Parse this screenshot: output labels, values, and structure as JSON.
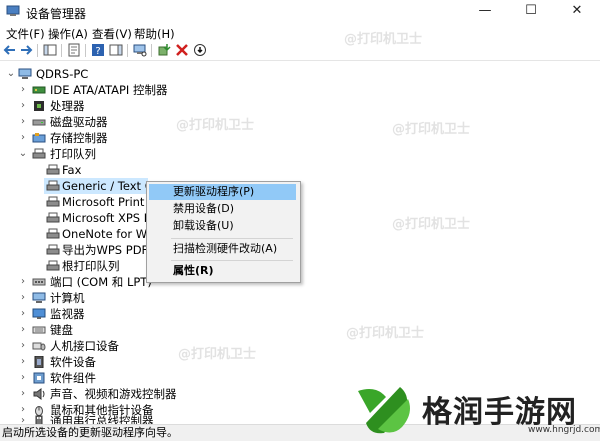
{
  "window": {
    "title": "设备管理器",
    "minimize_glyph": "—",
    "maximize_glyph": "☐",
    "close_glyph": "✕"
  },
  "menu": [
    "文件(F)",
    "操作(A)",
    "查看(V)",
    "帮助(H)"
  ],
  "tree": {
    "root": "QDRS-PC",
    "items": [
      {
        "label": "IDE ATA/ATAPI 控制器",
        "icon": "ide-controller-icon"
      },
      {
        "label": "处理器",
        "icon": "processor-icon"
      },
      {
        "label": "磁盘驱动器",
        "icon": "disk-drive-icon"
      },
      {
        "label": "存储控制器",
        "icon": "storage-controller-icon"
      },
      {
        "label": "打印队列",
        "icon": "print-queue-icon"
      },
      {
        "label": "Fax",
        "icon": "printer-icon"
      },
      {
        "label": "Generic / Text Only",
        "icon": "printer-icon"
      },
      {
        "label": "Microsoft Print to",
        "icon": "printer-icon"
      },
      {
        "label": "Microsoft XPS Doc",
        "icon": "printer-icon"
      },
      {
        "label": "OneNote for Wind",
        "icon": "printer-icon"
      },
      {
        "label": "导出为WPS PDF",
        "icon": "printer-icon"
      },
      {
        "label": "根打印队列",
        "icon": "printer-icon"
      },
      {
        "label": "端口 (COM 和 LPT)",
        "icon": "port-icon"
      },
      {
        "label": "计算机",
        "icon": "computer-icon"
      },
      {
        "label": "监视器",
        "icon": "monitor-icon"
      },
      {
        "label": "键盘",
        "icon": "keyboard-icon"
      },
      {
        "label": "人机接口设备",
        "icon": "hid-icon"
      },
      {
        "label": "软件设备",
        "icon": "software-device-icon"
      },
      {
        "label": "软件组件",
        "icon": "software-component-icon"
      },
      {
        "label": "声音、视频和游戏控制器",
        "icon": "sound-icon"
      },
      {
        "label": "鼠标和其他指针设备",
        "icon": "mouse-icon"
      },
      {
        "label": "通用串行总线控制器",
        "icon": "usb-icon"
      }
    ]
  },
  "context_menu": {
    "update_driver": "更新驱动程序(P)",
    "disable_device": "禁用设备(D)",
    "uninstall_device": "卸载设备(U)",
    "scan_hardware": "扫描检测硬件改动(A)",
    "properties": "属性(R)"
  },
  "status_bar": "启动所选设备的更新驱动程序向导。",
  "watermark": "@打印机卫士",
  "logo": {
    "brand": "格润手游网",
    "url": "www.hngrjd.com"
  },
  "colors": {
    "selection": "#cce8ff",
    "menu_highlight": "#91c9f7",
    "logo_green": "#3aa629"
  }
}
